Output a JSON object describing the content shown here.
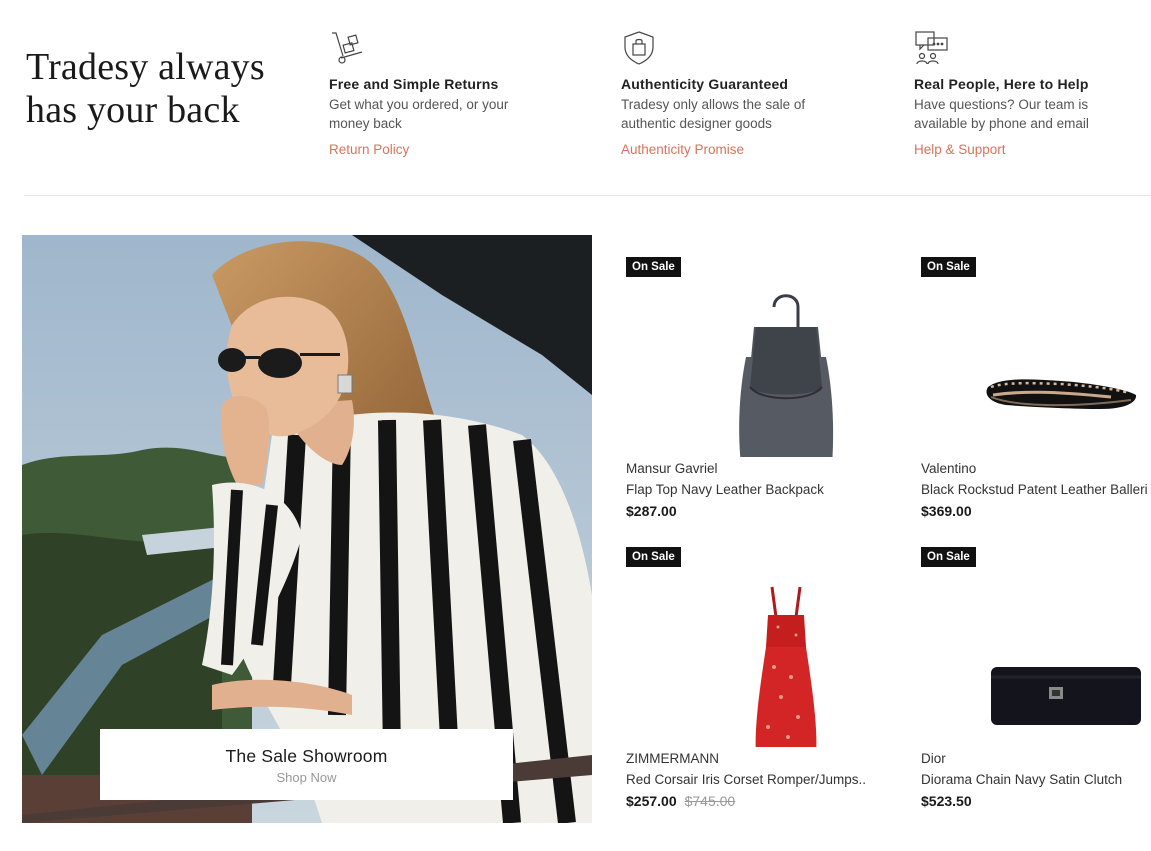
{
  "headline": {
    "line1": "Tradesy always",
    "line2": "has your back"
  },
  "features": [
    {
      "icon": "hand-truck-icon",
      "title": "Free and Simple Returns",
      "desc": "Get what you ordered, or your money back",
      "link": "Return Policy"
    },
    {
      "icon": "shield-bag-icon",
      "title": "Authenticity Guaranteed",
      "desc": "Tradesy only allows the sale of authentic designer goods",
      "link": "Authenticity Promise"
    },
    {
      "icon": "chat-people-icon",
      "title": "Real People, Here to Help",
      "desc": "Have questions? Our team is available by phone and email",
      "link": "Help & Support"
    }
  ],
  "hero": {
    "title": "The Sale Showroom",
    "cta": "Shop Now"
  },
  "products": [
    {
      "badge": "On Sale",
      "brand": "Mansur Gavriel",
      "name": "Flap Top Navy Leather Backpack",
      "price": "$287.00",
      "original_price": "",
      "image": "backpack"
    },
    {
      "badge": "On Sale",
      "brand": "Valentino",
      "name": "Black Rockstud Patent Leather Balleri",
      "price": "$369.00",
      "original_price": "",
      "image": "flat-shoe"
    },
    {
      "badge": "On Sale",
      "brand": "ZIMMERMANN",
      "name": "Red Corsair Iris Corset Romper/Jumps...",
      "price": "$257.00",
      "original_price": "$745.00",
      "image": "red-dress"
    },
    {
      "badge": "On Sale",
      "brand": "Dior",
      "name": "Diorama Chain Navy Satin Clutch",
      "price": "$523.50",
      "original_price": "",
      "image": "clutch"
    }
  ],
  "colors": {
    "link": "#d9735e",
    "badge_bg": "#111111",
    "divider": "#e6e6e6"
  }
}
